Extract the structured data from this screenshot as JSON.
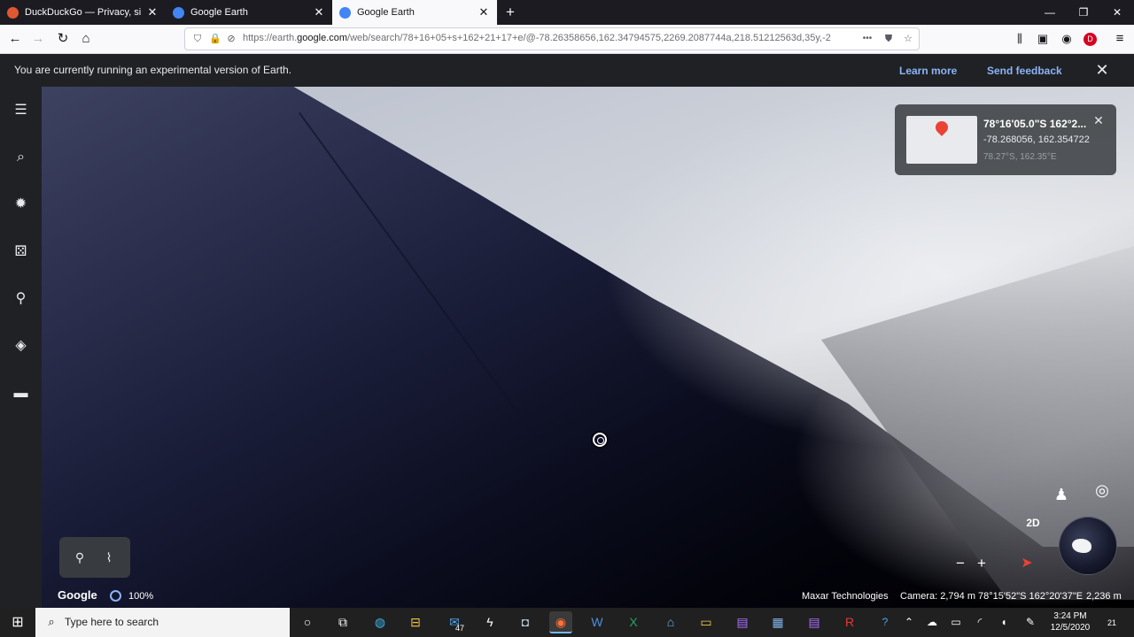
{
  "browser": {
    "tabs": [
      {
        "title": "DuckDuckGo — Privacy, simplified.",
        "favicon_color": "#de5833"
      },
      {
        "title": "Google Earth",
        "favicon_color": "#4285f4"
      },
      {
        "title": "Google Earth",
        "favicon_color": "#4285f4"
      }
    ],
    "tab_close": "✕",
    "new_tab": "+",
    "window_controls": {
      "minimize": "—",
      "maximize": "❐",
      "close": "✕"
    },
    "nav": {
      "back": "←",
      "forward": "→",
      "reload": "↻",
      "home": "⌂"
    },
    "url_prefix": "https://earth.",
    "url_domain": "google.com",
    "url_rest": "/web/search/78+16+05+s+162+21+17+e/@-78.26358656,162.34794575,2269.2087744a,218.51212563d,35y,-2",
    "url_overflow": "•••",
    "profile_initial": "D"
  },
  "banner": {
    "message": "You are currently running an experimental version of Earth.",
    "learn_more": "Learn more",
    "send_feedback": "Send feedback",
    "close": "✕"
  },
  "rail": {
    "icons": [
      "menu-icon",
      "search-icon",
      "voyager-icon",
      "feeling-lucky-icon",
      "projects-icon",
      "map-style-icon",
      "measure-icon"
    ]
  },
  "info_card": {
    "title": "78°16'05.0\"S 162°2...",
    "coords": "-78.268056, 162.354722",
    "short_coords": "78.27°S, 162.35°E",
    "close": "✕"
  },
  "map_controls": {
    "two_d": "2D",
    "zoom_out": "−",
    "zoom_in": "+"
  },
  "status": {
    "logo": "Google",
    "load_percent": "100%",
    "attribution": "Maxar Technologies",
    "camera": "Camera: 2,794 m",
    "coords": "78°15'52\"S 162°20'37\"E",
    "elevation": "2,236 m"
  },
  "taskbar": {
    "search_placeholder": "Type here to search",
    "mail_badge": "47",
    "time": "3:24 PM",
    "date": "12/5/2020",
    "notification_count": "21"
  },
  "colors": {
    "banner_bg": "#202124",
    "link_blue": "#8ab4f8",
    "pin_red": "#ea4335"
  }
}
